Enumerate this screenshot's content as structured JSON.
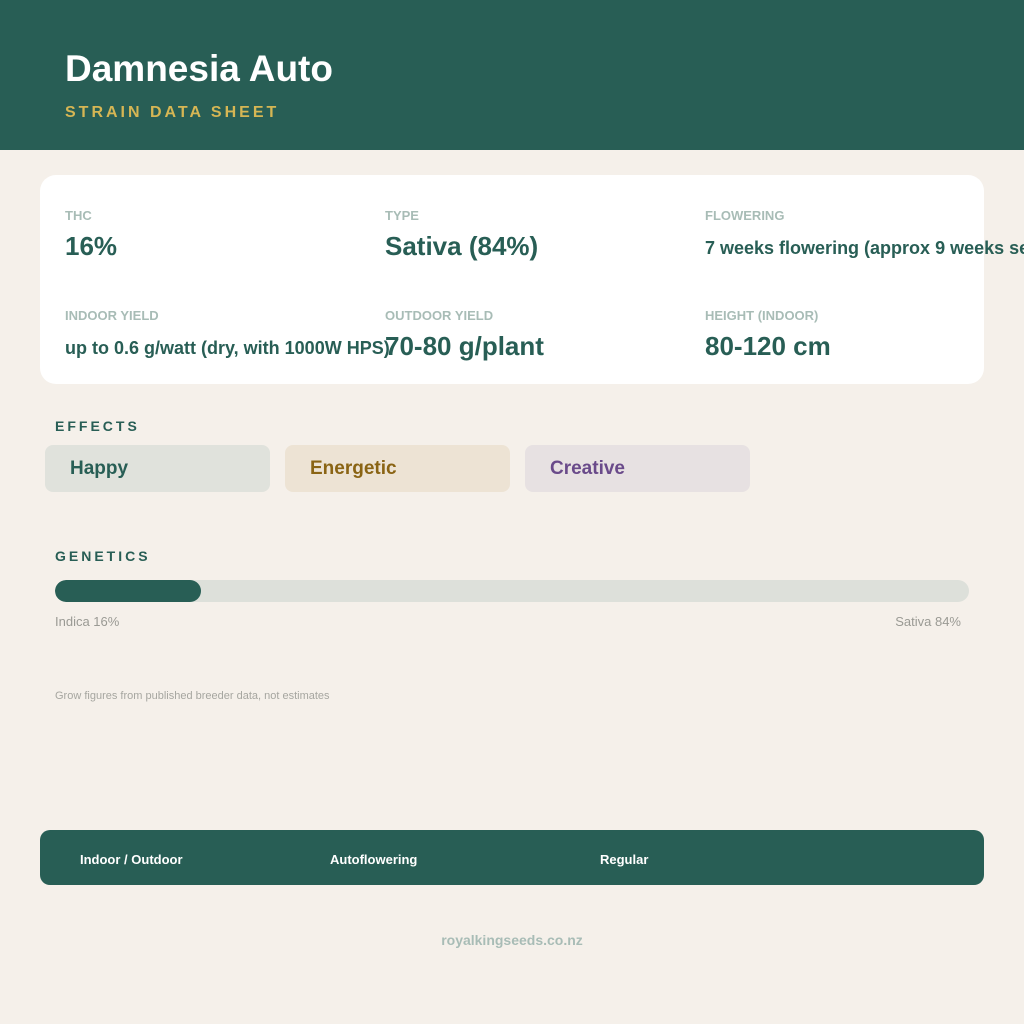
{
  "header": {
    "title": "Damnesia Auto",
    "subtitle": "STRAIN DATA SHEET",
    "background_color": "#285e55",
    "subtitle_color": "#d6b654"
  },
  "stats": [
    {
      "label": "THC",
      "value": "16%"
    },
    {
      "label": "TYPE",
      "value": "Sativa (84%)"
    },
    {
      "label": "FLOWERING",
      "value": "7 weeks flowering (approx 9 weeks se"
    },
    {
      "label": "INDOOR YIELD",
      "value": "up to 0.6 g/watt (dry, with 1000W HPS)"
    },
    {
      "label": "OUTDOOR YIELD",
      "value": "70-80 g/plant"
    },
    {
      "label": "HEIGHT (INDOOR)",
      "value": "80-120 cm"
    }
  ],
  "effects": {
    "title": "EFFECTS",
    "tags": [
      {
        "label": "Happy",
        "text_color": "#285e55",
        "bg_color": "#e0e2dc"
      },
      {
        "label": "Energetic",
        "text_color": "#8a6414",
        "bg_color": "#ede3d4"
      },
      {
        "label": "Creative",
        "text_color": "#6a4a8a",
        "bg_color": "#e7e1e2"
      }
    ]
  },
  "genetics": {
    "title": "GENETICS",
    "indica_fraction": 0.16,
    "indica_label": "Indica 16%",
    "sativa_label": "Sativa 84%"
  },
  "footnote": "Grow figures from published breeder data, not estimates",
  "footer": {
    "items": [
      "Indoor / Outdoor",
      "Autoflowering",
      "Regular"
    ]
  },
  "website": "royalkingseeds.co.nz"
}
